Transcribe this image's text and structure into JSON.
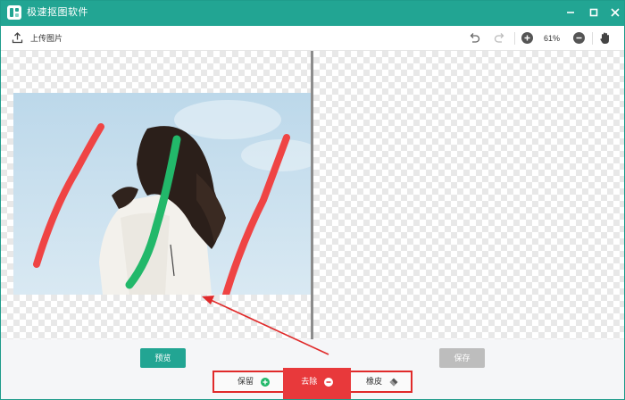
{
  "window": {
    "title": "极速抠图软件",
    "controls": [
      "minimize-icon",
      "maximize-icon",
      "close-icon"
    ]
  },
  "toolbar": {
    "upload_label": "上传图片",
    "upload_icon": "upload-icon",
    "undo_icon": "undo-icon",
    "redo_icon": "redo-icon",
    "zoom_in_icon": "zoom-in-icon",
    "zoom_level": "61%",
    "zoom_out_icon": "zoom-out-icon",
    "pan_icon": "hand-icon"
  },
  "actions": {
    "preview_label": "预览",
    "save_label": "保存"
  },
  "tools": {
    "keep_label": "保留",
    "remove_label": "去除",
    "eraser_label": "橡皮"
  },
  "colors": {
    "brand": "#22a593",
    "keep_stroke": "#22b86a",
    "remove_stroke": "#ef4444",
    "annotation": "#e02a2a"
  }
}
